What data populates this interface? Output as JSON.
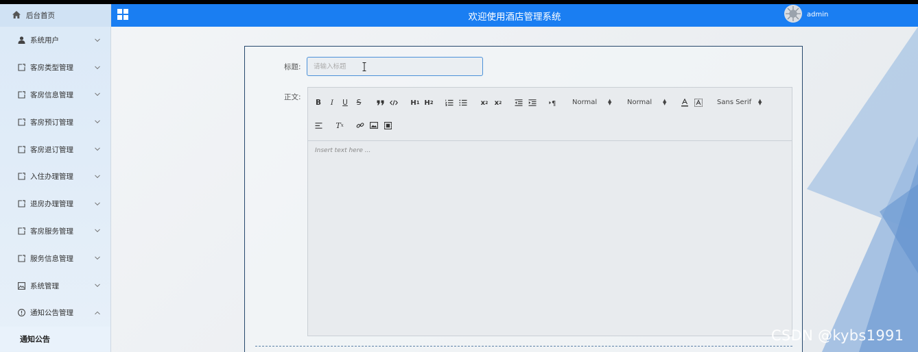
{
  "sidebar": {
    "home_label": "后台首页",
    "items": [
      {
        "label": "系统用户",
        "icon": "user-icon"
      },
      {
        "label": "客房类型管理",
        "icon": "external-link-icon"
      },
      {
        "label": "客房信息管理",
        "icon": "external-link-icon"
      },
      {
        "label": "客房预订管理",
        "icon": "external-link-icon"
      },
      {
        "label": "客房退订管理",
        "icon": "external-link-icon"
      },
      {
        "label": "入住办理管理",
        "icon": "external-link-icon"
      },
      {
        "label": "退房办理管理",
        "icon": "external-link-icon"
      },
      {
        "label": "客房服务管理",
        "icon": "external-link-icon"
      },
      {
        "label": "服务信息管理",
        "icon": "external-link-icon"
      },
      {
        "label": "系统管理",
        "icon": "picture-icon"
      },
      {
        "label": "通知公告管理",
        "icon": "info-icon"
      }
    ],
    "sub_item": "通知公告"
  },
  "header": {
    "title": "欢迎使用酒店管理系统",
    "user": "admin"
  },
  "form": {
    "title_label": "标题:",
    "title_placeholder": "请输入标题",
    "title_value": "",
    "content_label": "正文:",
    "editor_placeholder": "Insert text here ...",
    "size_select": "Normal",
    "header_select": "Normal",
    "font_select": "Sans Serif"
  },
  "watermark": "CSDN @kybs1991",
  "colors": {
    "topbar": "#1a7ef2",
    "card_border": "#24466b",
    "input_border": "#4a90d9"
  }
}
